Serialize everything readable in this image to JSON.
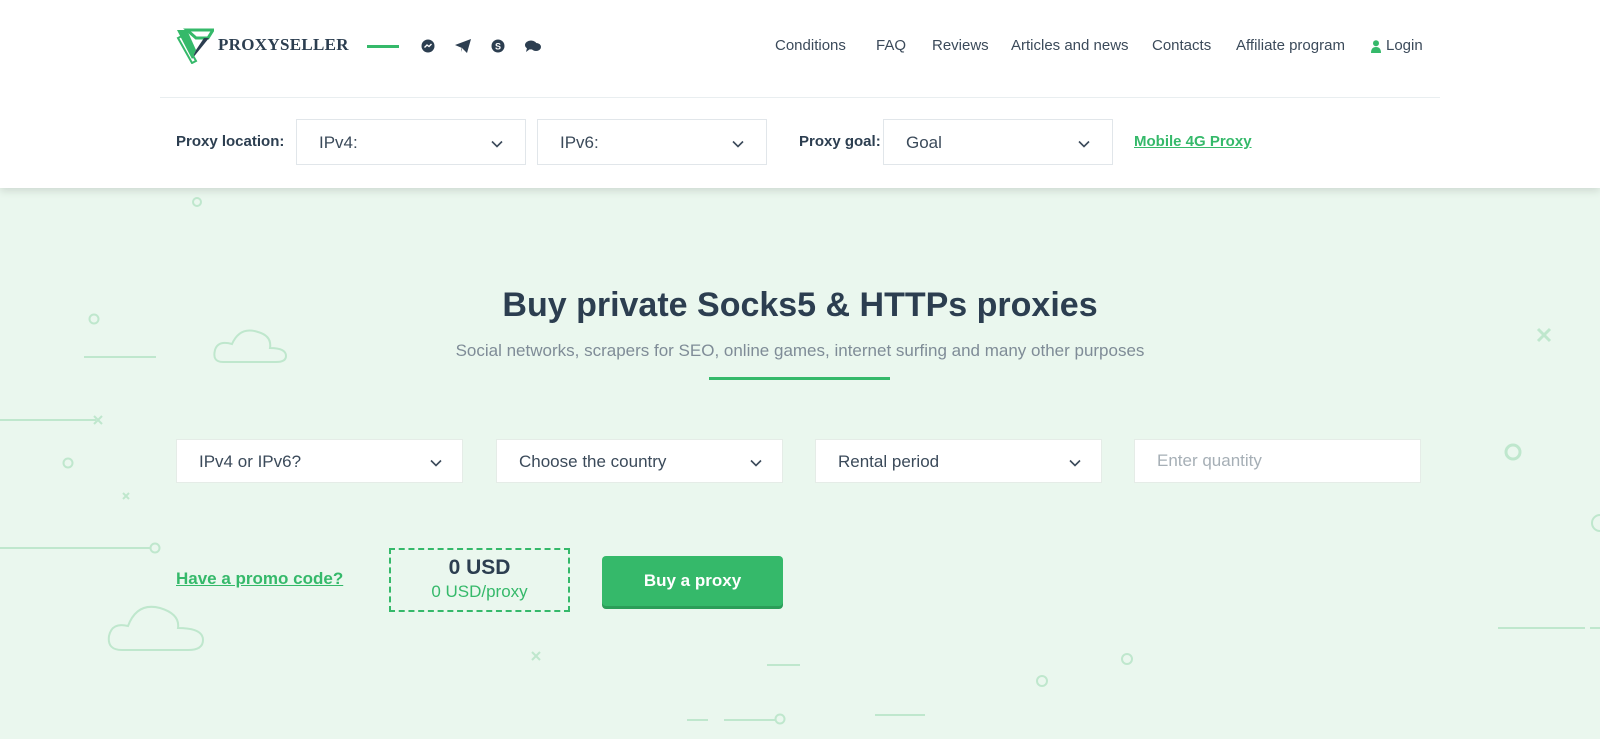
{
  "brand": {
    "name": "PROXYSELLER",
    "accent": "#35b96a",
    "dark_text": "#2c3e50",
    "hero_background": "#eaf7ee"
  },
  "social_icons": [
    "messenger-icon",
    "telegram-icon",
    "skype-icon",
    "chat-icon"
  ],
  "nav": {
    "conditions": "Conditions",
    "faq": "FAQ",
    "reviews": "Reviews",
    "articles": "Articles and news",
    "contacts": "Contacts",
    "affiliate": "Affiliate program",
    "login": "Login",
    "login_icon": "user-icon"
  },
  "filters": {
    "location_label": "Proxy location:",
    "ipv4_value": "IPv4:",
    "ipv6_value": "IPv6:",
    "goal_label": "Proxy goal:",
    "goal_value": "Goal",
    "mobile_link": "Mobile 4G Proxy"
  },
  "hero": {
    "title": "Buy private Socks5 & HTTPs proxies",
    "subtitle": "Social networks, scrapers for SEO, online games, internet surfing and many other purposes"
  },
  "order_form": {
    "protocol": "IPv4 or IPv6?",
    "country": "Choose the country",
    "period": "Rental period",
    "quantity_placeholder": "Enter quantity",
    "quantity_value": "",
    "promo": "Have a promo code?",
    "total": "0 USD",
    "per_proxy": "0 USD/proxy",
    "buy": "Buy a proxy"
  }
}
